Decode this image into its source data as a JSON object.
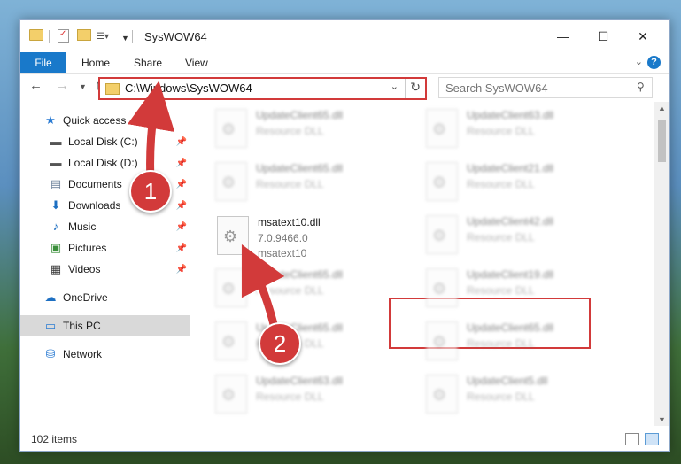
{
  "window": {
    "title": "SysWOW64",
    "controls": {
      "minimize": "—",
      "maximize": "☐",
      "close": "✕"
    }
  },
  "ribbon": {
    "tabs": [
      "File",
      "Home",
      "Share",
      "View"
    ],
    "help": "?"
  },
  "address": {
    "path": "C:\\Windows\\SysWOW64",
    "search_placeholder": "Search SysWOW64"
  },
  "sidebar": {
    "items": [
      {
        "label": "Quick access",
        "icon": "star-icon",
        "pinned": false
      },
      {
        "label": "Local Disk (C:)",
        "icon": "drive-icon",
        "pinned": true
      },
      {
        "label": "Local Disk (D:)",
        "icon": "drive-icon",
        "pinned": true
      },
      {
        "label": "Documents",
        "icon": "documents-icon",
        "pinned": true
      },
      {
        "label": "Downloads",
        "icon": "download-icon",
        "pinned": true
      },
      {
        "label": "Music",
        "icon": "music-icon",
        "pinned": true
      },
      {
        "label": "Pictures",
        "icon": "pictures-icon",
        "pinned": true
      },
      {
        "label": "Videos",
        "icon": "videos-icon",
        "pinned": true
      },
      {
        "label": "OneDrive",
        "icon": "cloud-icon",
        "pinned": false
      },
      {
        "label": "This PC",
        "icon": "computer-icon",
        "pinned": false,
        "selected": true
      },
      {
        "label": "Network",
        "icon": "network-icon",
        "pinned": false
      }
    ]
  },
  "files": {
    "blurred": [
      {
        "name": "UpdateClient65.dll",
        "type": "Resource DLL"
      },
      {
        "name": "UpdateClient63.dll",
        "type": "Resource DLL"
      },
      {
        "name": "UpdateClient65.dll",
        "type": "Resource DLL"
      },
      {
        "name": "UpdateClient21.dll",
        "type": "Resource DLL"
      },
      {
        "name": "UpdateClient42.dll",
        "type": "Resource DLL"
      },
      {
        "name": "UpdateClient65.dll",
        "type": "Resource DLL"
      },
      {
        "name": "UpdateClient19.dll",
        "type": "Resource DLL"
      },
      {
        "name": "UpdateClient65.dll",
        "type": "Resource DLL"
      },
      {
        "name": "UpdateClient65.dll",
        "type": "Resource DLL"
      },
      {
        "name": "UpdateClient63.dll",
        "type": "Resource DLL"
      },
      {
        "name": "UpdateClient5.dll",
        "type": "Resource DLL"
      }
    ],
    "highlighted": {
      "name": "msatext10.dll",
      "version": "7.0.9466.0",
      "description": "msatext10"
    }
  },
  "status": {
    "item_count": "102 items"
  },
  "annotations": {
    "step1": "1",
    "step2": "2"
  },
  "colors": {
    "accent": "#1979ca",
    "highlight": "#d23a3a"
  }
}
